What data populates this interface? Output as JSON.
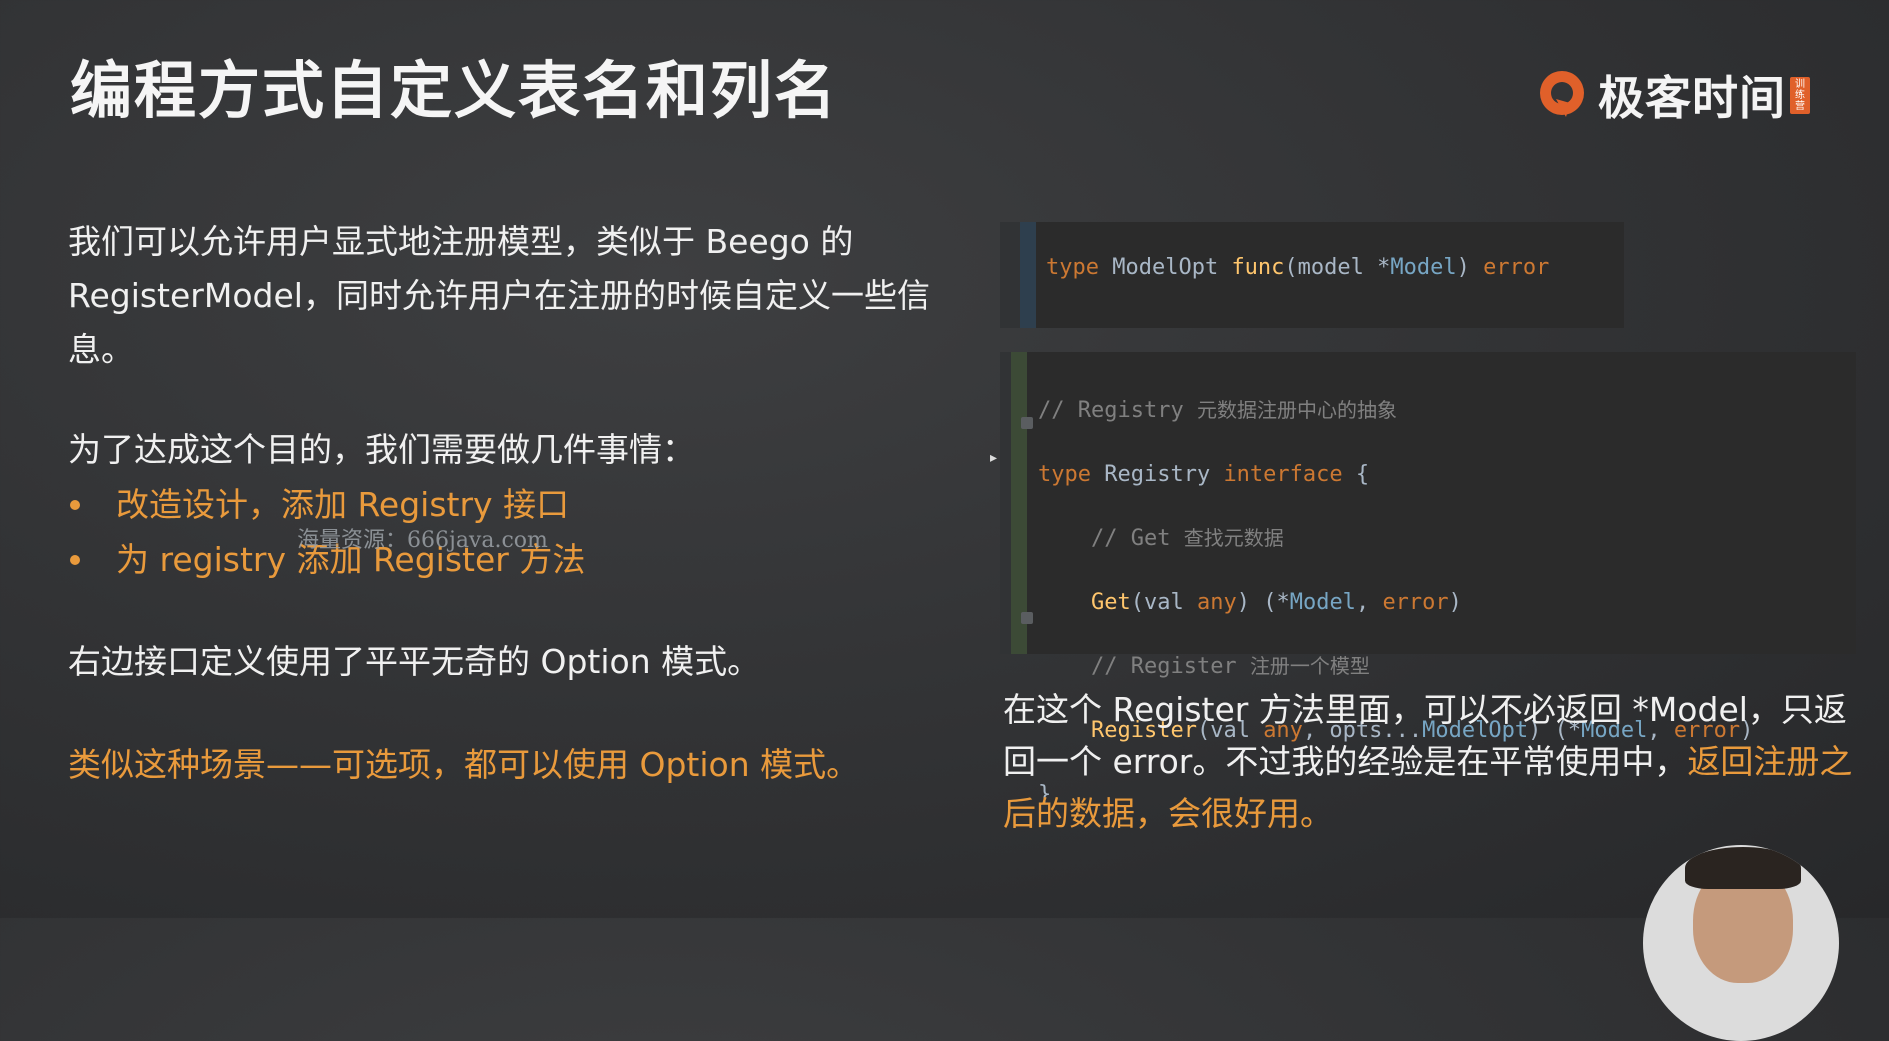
{
  "slide": {
    "title": "编程方式自定义表名和列名",
    "logo_text": "极客时间",
    "logo_badge": "训练营"
  },
  "left": {
    "para1": "我们可以允许用户显式地注册模型，类似于 Beego 的 RegisterModel，同时允许用户在注册的时候自定义一些信息。",
    "para2": "为了达成这个目的，我们需要做几件事情：",
    "bullets": [
      "改造设计，添加 Registry 接口",
      "为 registry 添加 Register 方法"
    ],
    "para3": "右边接口定义使用了平平无奇的 Option  模式。",
    "para4": "类似这种场景——可选项，都可以使用 Option 模式。"
  },
  "watermark": "海量资源：666java.com",
  "right": {
    "body_plain": "在这个 Register 方法里面，可以不必返回 *Model，只返回一个 error。不过我的经验是在平常使用中，",
    "body_highlight": "返回注册之后的数据，会很好用。"
  },
  "colors": {
    "accent": "#e99a3c",
    "background": "#333436",
    "code_bg": "#2b2b2b",
    "keyword": "#cc7832",
    "function": "#ffc66d",
    "comment": "#808080",
    "logo": "#e0602a"
  },
  "icons": [
    "geekbang-logo-icon",
    "fold-marker-icon",
    "mouse-cursor-icon"
  ]
}
